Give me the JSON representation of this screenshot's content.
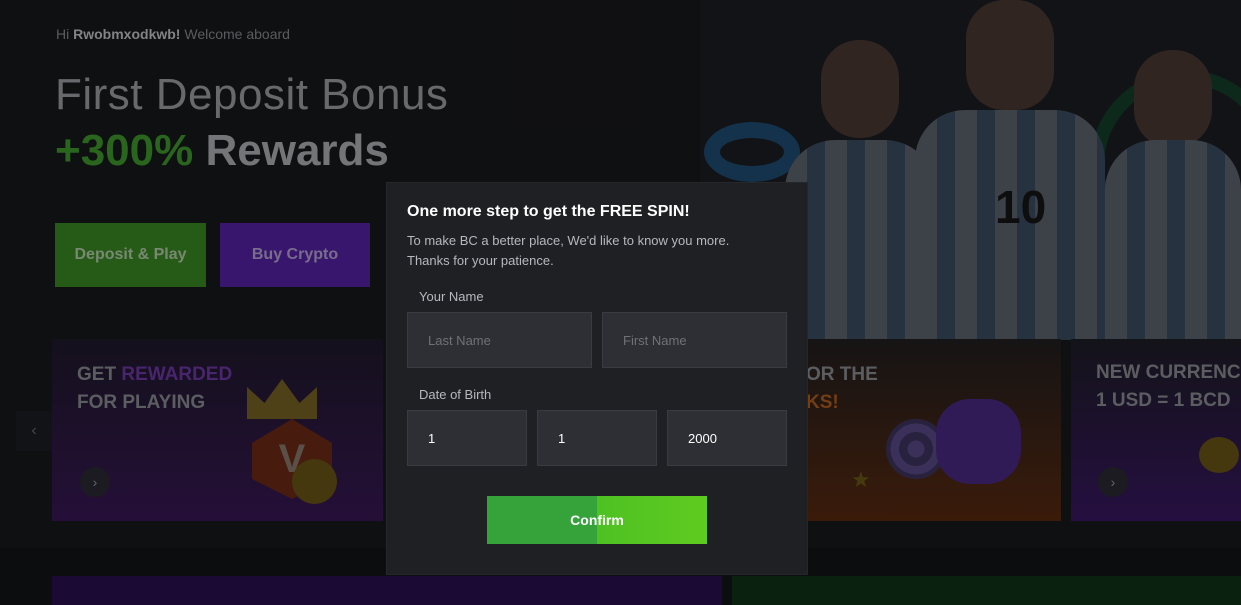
{
  "hero": {
    "greeting_prefix": "Hi",
    "username": "Rwobmxodkwb!",
    "greeting_suffix": "Welcome aboard",
    "title": "First Deposit Bonus",
    "bonus_percent": "+300%",
    "bonus_word": "Rewards",
    "deposit_button": "Deposit & Play",
    "crypto_button": "Buy Crypto"
  },
  "promos": [
    {
      "title_line1_a": "GET ",
      "title_line1_b": "REWARDED",
      "title_line2": "FOR PLAYING"
    },
    {
      "title_line1": "OR THE",
      "title_line2": "KS!"
    },
    {
      "title_line1": "NEW CURRENC",
      "title_line2": "1 USD = 1 BCD"
    }
  ],
  "badge_letter": "V",
  "jersey_number": "10",
  "modal": {
    "title": "One more step to get the FREE SPIN!",
    "description_line1": "To make BC a better place, We'd like to know you more.",
    "description_line2": "Thanks for your patience.",
    "name_label": "Your Name",
    "last_name_placeholder": "Last Name",
    "first_name_placeholder": "First Name",
    "dob_label": "Date of Birth",
    "dob_day": "1",
    "dob_month": "1",
    "dob_year": "2000",
    "confirm_button": "Confirm"
  },
  "icons": {
    "prev": "chevron-left-icon",
    "next": "chevron-right-icon"
  },
  "colors": {
    "accent_green": "#3f9b2c",
    "accent_purple": "#5822a8",
    "confirm_green": "#4ec123",
    "modal_bg": "#1e2024"
  }
}
